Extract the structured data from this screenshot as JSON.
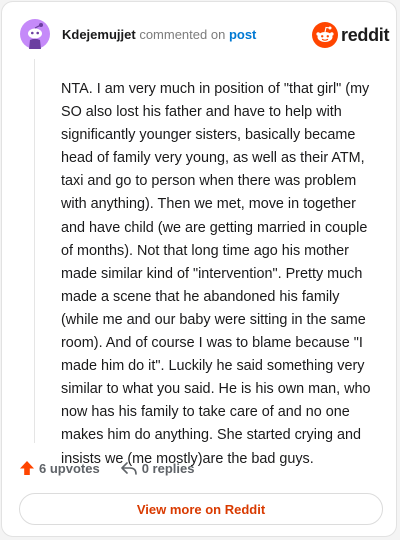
{
  "header": {
    "username": "Kdejemujjet",
    "action_text": "commented on",
    "post_link": "post"
  },
  "logo": {
    "text": "reddit",
    "icon": "reddit-alien-icon",
    "brand_color": "#ff4500"
  },
  "comment": {
    "body": "NTA. I am very much in position of \"that girl\" (my SO also lost his father and have to help with significantly younger sisters, basically became head of family very young, as well as their ATM, taxi and go to person when there was problem with anything). Then we met, move in together and have child (we are getting married in couple of months). Not that long time ago his mother made similar kind of \"intervention\". Pretty much made a scene that he abandoned his family (while me and our baby were sitting in the same room). And of course I was to blame because \"I made him do it\". Luckily he said something very similar to what you said. He is his own man, who now has his family to take care of and no one makes him do anything. She started crying and insists we (me mostly)are the bad guys."
  },
  "footer": {
    "upvotes": "6 upvotes",
    "replies": "0 replies",
    "upvote_icon": "upvote-arrow-icon",
    "reply_icon": "reply-arrow-icon"
  },
  "cta": {
    "label": "View more on Reddit",
    "color": "#d93a00"
  },
  "avatar": {
    "icon": "snoo-avatar-icon",
    "color": "#c58af9"
  }
}
